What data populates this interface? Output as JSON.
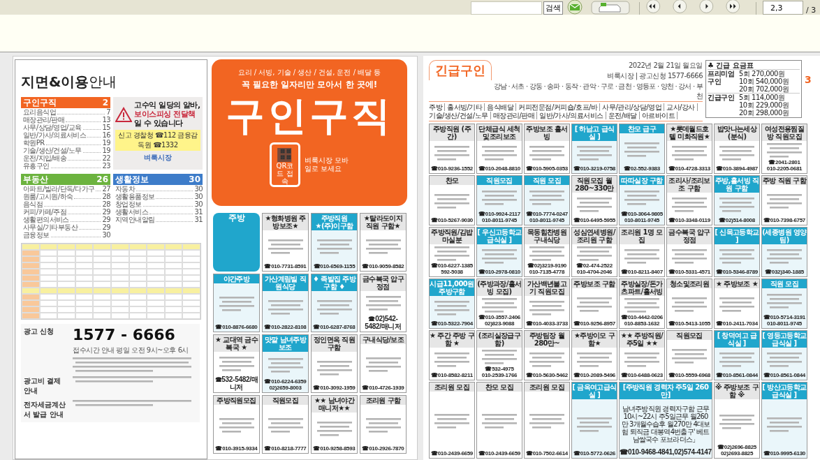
{
  "toolbar": {
    "search_button": "검색",
    "page_field": {
      "value": "2,3"
    },
    "page_total": "/ 3"
  },
  "left_page": {
    "guide": {
      "title": "**지면&이용**안내",
      "sections": [
        {
          "name": "구인구직",
          "page": "2",
          "color": "#f26522",
          "items": [
            {
              "label": "요리음식업",
              "page": "7"
            },
            {
              "label": "매장관리/판매",
              "page": "13"
            },
            {
              "label": "사무/상담/영업/교육",
              "page": "15"
            },
            {
              "label": "일반/가사/의료서비스",
              "page": "16"
            },
            {
              "label": "학원PR",
              "page": "19"
            },
            {
              "label": "기술/생산/건설/노무",
              "page": "19"
            },
            {
              "label": "운전/지입/배송",
              "page": "22"
            },
            {
              "label": "유흥구인",
              "page": "23"
            }
          ]
        },
        {
          "name": "부동산",
          "page": "26",
          "color": "#6cb33f",
          "items": [
            {
              "label": "아파트/빌라/단독/다가구",
              "page": "27"
            },
            {
              "label": "원룸/고시원/하숙",
              "page": "28"
            },
            {
              "label": "음식점",
              "page": "28"
            },
            {
              "label": "커피/카페/주점",
              "page": "29"
            },
            {
              "label": "생활편의서비스",
              "page": "29"
            },
            {
              "label": "사무실/기타부동산",
              "page": "29"
            },
            {
              "label": "금융정보",
              "page": "30"
            }
          ]
        },
        {
          "name": "생활정보",
          "page": "30",
          "color": "#3d7cc9",
          "items": [
            {
              "label": "자동차",
              "page": "30"
            },
            {
              "label": "생활용품정보",
              "page": "30"
            },
            {
              "label": "창업정보",
              "page": "30"
            },
            {
              "label": "생활서비스",
              "page": "31"
            },
            {
              "label": "지역안내알림",
              "page": "31"
            }
          ]
        }
      ],
      "warning": {
        "lines": [
          "고수익 일당의 알바,",
          "보이스피싱 전달책",
          "일 수 있습니다"
        ],
        "report": "신고 경찰청 ☎112 금융감독원 ☎1332",
        "brand": "벼룩시장"
      },
      "info": [
        {
          "heading": "광고 신청",
          "number": "1577 - 6666",
          "note": "접수시간 안내 평일 오전 9시~오후 6시"
        },
        {
          "heading": "광고비 결제 안내"
        },
        {
          "heading": "전자세금계산서 발급 안내"
        }
      ]
    },
    "banner": {
      "subtitle": "요리 / 서빙, 기술 / 생산 / 건설, 운전 / 배달 등",
      "tagline": "꼭 필요한 일자리만 모아서 한 곳에!",
      "title": "구인구직",
      "qr_label": "QR코드 접속",
      "mobile": "벼룩시장 모바일로 보세요"
    },
    "ads": [
      {
        "kind": "category",
        "title": "주방"
      },
      {
        "kind": "ad",
        "title": "★형화병원 주방보조★",
        "highlight": false,
        "phones": [
          "☎010-7731-8591"
        ]
      },
      {
        "kind": "ad",
        "title": "주방직원 ★(주)이구함",
        "highlight": true,
        "phones": [
          "☎010-6569-1155"
        ]
      },
      {
        "kind": "ad",
        "title": "★탈라도이지 직원 구함★",
        "highlight": false,
        "phones": [
          "☎010-9059-8582"
        ]
      },
      {
        "kind": "ad",
        "title": "야간주방",
        "highlight": true,
        "phones": [
          "☎010-8876-6680"
        ]
      },
      {
        "kind": "ad",
        "title": "가산계림빌 직원식당",
        "highlight": true,
        "phones": [
          "☎010-2822-8108"
        ]
      },
      {
        "kind": "ad",
        "title": "♦ 족발집 주방 구함 ♦",
        "highlight": true,
        "phones": [
          "☎010-6287-8768"
        ]
      },
      {
        "kind": "ad",
        "title": "금수복국 압구정점",
        "highlight": false,
        "phones": [
          "☎02)542-5482/매니저"
        ]
      },
      {
        "kind": "ad",
        "title": "★ 교대역 금수복국 ★",
        "highlight": false,
        "phones": [
          "☎532-5482/매니저"
        ]
      },
      {
        "kind": "ad",
        "title": "맛깔 남녀주방보조",
        "highlight": true,
        "phones": [
          "☎010-6224-6359",
          "02)2659-8003"
        ]
      },
      {
        "kind": "ad",
        "title": "정인면옥 직원 구함",
        "highlight": false,
        "phones": [
          "☎010-3092-1959"
        ]
      },
      {
        "kind": "ad",
        "title": "구내식당/보조",
        "highlight": false,
        "phones": [
          "☎010-4726-1939"
        ]
      },
      {
        "kind": "ad",
        "title": "주방직원모집",
        "highlight": false,
        "phones": [
          "☎010-3915-9334"
        ]
      },
      {
        "kind": "ad",
        "title": "직원모집",
        "highlight": false,
        "phones": [
          "☎010-8218-7777"
        ]
      },
      {
        "kind": "ad",
        "title": "★★ 남녀야간매니저★★",
        "highlight": false,
        "phones": [
          "☎010-9258-8593"
        ]
      },
      {
        "kind": "ad",
        "title": "조리원 구함",
        "highlight": false,
        "phones": [
          "☎010-2926-7870"
        ]
      }
    ]
  },
  "right_page": {
    "title": "긴급구인",
    "date": "2022년 2월 21일 월요일",
    "contact": "벼룩시장 | 광고신청 1577-6666",
    "areas": "강남 · 서초 · 강동 · 송파 · 동작 · 관악 · 구로 · 금천 · 영등포 · 양천 · 강서 · 부천",
    "categories": [
      "주방",
      "홀서빙/기타",
      "음식배달",
      "커피전문점/커피숍/호프/바",
      "사무/관리/상담/영업",
      "교사/강사",
      "기술/생산/건설/노무",
      "매장관리/판매",
      "일반/가사/의료서비스",
      "운전/배달",
      "아르바이트"
    ],
    "rates": {
      "title": "♣ 긴급 요금표",
      "rows": [
        {
          "label": "프리미엄 구인",
          "prices": [
            "5회 270,000원",
            "10회 540,000원",
            "20회 702,000원"
          ]
        },
        {
          "label": "긴급구인",
          "prices": [
            "5회 114,000원",
            "10회 229,000원",
            "20회 298,000원"
          ]
        }
      ]
    },
    "page_number": "3",
    "ads": [
      {
        "kind": "ad",
        "title": "주방직원 (주간)",
        "highlight": false,
        "phones": [
          "☎010-9236-1552"
        ]
      },
      {
        "kind": "ad",
        "title": "단체급식 세척및조리보조",
        "highlight": false,
        "phones": [
          "☎010-2048-8810"
        ]
      },
      {
        "kind": "ad",
        "title": "주방보조 홀서빙",
        "highlight": false,
        "phones": [
          "☎010-5905-0353"
        ]
      },
      {
        "kind": "ad",
        "title": "[ 하남고 급식실 ]",
        "highlight": true,
        "phones": [
          "☎010-3219-0758"
        ]
      },
      {
        "kind": "ad",
        "title": "찬모 급구",
        "highlight": true,
        "phones": [
          "☎02-552-9383"
        ]
      },
      {
        "kind": "ad",
        "title": "★롯데월드호텔 미화직원★",
        "highlight": false,
        "phones": [
          "☎010-4728-3313"
        ]
      },
      {
        "kind": "ad",
        "title": "밥맛나는세상(분식)",
        "highlight": false,
        "phones": [
          "☎010-3894-4987"
        ]
      },
      {
        "kind": "ad",
        "title": "여성전용찜질방 직원모집",
        "highlight": false,
        "phones": [
          "☎2041-2801",
          "010-2205-0681"
        ]
      },
      {
        "kind": "ad",
        "title": "찬모",
        "highlight": false,
        "phones": [
          "☎010-5267-9030"
        ]
      },
      {
        "kind": "ad",
        "title": "직원모집",
        "highlight": true,
        "phones": [
          "☎010-9924-2117",
          "010-8011-9745"
        ]
      },
      {
        "kind": "ad",
        "title": "직원 모집",
        "highlight": true,
        "phones": [
          "☎010-7774-0247",
          "010-8011-9745"
        ]
      },
      {
        "kind": "ad",
        "title": "직원모집 월280~330만",
        "highlight": false,
        "phones": [
          "☎010-6495-5955"
        ]
      },
      {
        "kind": "ad",
        "title": "따따실장 구함",
        "highlight": true,
        "phones": [
          "☎010-3064-9805",
          "010-8011-9745"
        ]
      },
      {
        "kind": "ad",
        "title": "조리사/조리보조 구함",
        "highlight": false,
        "phones": [
          "☎010-3348-0119"
        ]
      },
      {
        "kind": "ad",
        "title": "주방,홀서빙 직원 구함",
        "highlight": true,
        "phones": [
          "☎02)514-8008"
        ]
      },
      {
        "kind": "ad",
        "title": "주방 직원 구함",
        "highlight": false,
        "phones": [
          "☎010-7398-6757"
        ]
      },
      {
        "kind": "ad",
        "title": "주방직원/김밥마실분",
        "highlight": false,
        "phones": [
          "☎010-6227-1385",
          "592-5038"
        ]
      },
      {
        "kind": "ad",
        "title": "[ 우신고등학교 급식실 ]",
        "highlight": true,
        "phones": [
          "☎010-2978-0810"
        ]
      },
      {
        "kind": "ad",
        "title": "목동힘찬병원 구내식당",
        "highlight": false,
        "phones": [
          "☎02)3219-9190",
          "010-7135-4778"
        ]
      },
      {
        "kind": "ad",
        "title": "성심연세병원/조리원 구함",
        "highlight": false,
        "phones": [
          "☎02-474-2522",
          "010-4704-2046"
        ]
      },
      {
        "kind": "ad",
        "title": "조리원 1명 모집",
        "highlight": false,
        "phones": [
          "☎010-8211-8407"
        ]
      },
      {
        "kind": "ad",
        "title": "금수복국 압구정점",
        "highlight": false,
        "phones": [
          "☎010-5331-4571"
        ]
      },
      {
        "kind": "ad",
        "title": "[ 신목고등학교 ]",
        "highlight": true,
        "phones": [
          "☎010-5346-8789"
        ]
      },
      {
        "kind": "ad",
        "title": "(세종병원 영양팀)",
        "highlight": true,
        "phones": [
          "☎032)340-1885"
        ]
      },
      {
        "kind": "ad",
        "title": "시급11,000원 주방구함",
        "highlight": true,
        "phones": [
          "☎010-5322-7904"
        ]
      },
      {
        "kind": "ad",
        "title": "(주방과장/홀서빙 모집)",
        "highlight": false,
        "phones": [
          "☎010-3557-2406",
          "02)823-9088"
        ]
      },
      {
        "kind": "ad",
        "title": "가산백년불고기 직원모집",
        "highlight": false,
        "phones": [
          "☎010-4033-3733"
        ]
      },
      {
        "kind": "ad",
        "title": "주방보조 구함",
        "highlight": false,
        "phones": [
          "☎010-9256-8957"
        ]
      },
      {
        "kind": "ad",
        "title": "주방실장/돈가츠파트/홀서빙",
        "highlight": false,
        "phones": [
          "☎010-4442-0206",
          "010-8853-1632"
        ]
      },
      {
        "kind": "ad",
        "title": "청소및조리원",
        "highlight": false,
        "phones": [
          "☎010-5413-1055"
        ]
      },
      {
        "kind": "ad",
        "title": "★ 주방보조 ★",
        "highlight": false,
        "phones": [
          "☎010-2411-7034"
        ]
      },
      {
        "kind": "ad",
        "title": "직원 모집",
        "highlight": true,
        "phones": [
          "☎010-5714-3191",
          "010-8011-9745"
        ]
      },
      {
        "kind": "ad",
        "title": "★ 주간 주방 구함 ★",
        "highlight": false,
        "phones": [
          "☎010-8582-8211"
        ]
      },
      {
        "kind": "ad",
        "title": "(조리실장급구함)",
        "highlight": false,
        "phones": [
          "☎532-4975",
          "010-2539-1766"
        ]
      },
      {
        "kind": "ad",
        "title": "주방팀장 월280만~",
        "highlight": false,
        "phones": [
          "☎010-5630-5462"
        ]
      },
      {
        "kind": "ad",
        "title": "★주방이모 구함★",
        "highlight": false,
        "phones": [
          "☎010-2089-5496"
        ]
      },
      {
        "kind": "ad",
        "title": "★★ 주방직원/주5일 ★★",
        "highlight": false,
        "phones": [
          "☎010-6488-0623"
        ]
      },
      {
        "kind": "ad",
        "title": "직원모집",
        "highlight": false,
        "phones": [
          "☎010-5559-6968"
        ]
      },
      {
        "kind": "ad",
        "title": "[ 창덕여고 급식실 ]",
        "highlight": true,
        "phones": [
          "☎010-8561-0844"
        ]
      },
      {
        "kind": "ad",
        "title": "[ 영등고등학교 급식실 ]",
        "highlight": true,
        "phones": [
          "☎010-8561-0844"
        ]
      },
      {
        "kind": "ad",
        "title": "조리원 모집",
        "highlight": false,
        "phones": [
          "☎010-2439-6659"
        ]
      },
      {
        "kind": "ad",
        "title": "찬모 모집",
        "highlight": false,
        "phones": [
          "☎010-2439-6659"
        ]
      },
      {
        "kind": "ad",
        "title": "조리원 모집",
        "highlight": false,
        "phones": [
          "☎010-7502-6614"
        ]
      },
      {
        "kind": "ad",
        "title": "[ 금옥여고급식실 ]",
        "highlight": true,
        "phones": [
          "☎010-5772-0626"
        ]
      },
      {
        "kind": "wide",
        "title": "[주방직원 경력자 주5일 260만]",
        "highlight": true,
        "body": "남녀주방직원 경력자구함 근무10시~22시 주5일근무 월260만 3개월수습후 월270만 4대보험 퇴직금 대봉역4번출구' 베트남쌀국수 포브라더스」",
        "phones": [
          "☎010-9468-4841,02)574-4147"
        ]
      },
      {
        "kind": "ad",
        "title": "※ 주방보조 구함 ※",
        "highlight": false,
        "phones": [
          "☎02)2696-8825",
          "02)2693-8825"
        ]
      },
      {
        "kind": "ad",
        "title": "[ 방산고등학교 급식실 ]",
        "highlight": true,
        "phones": [
          "☎010-9995-6130"
        ]
      }
    ]
  }
}
